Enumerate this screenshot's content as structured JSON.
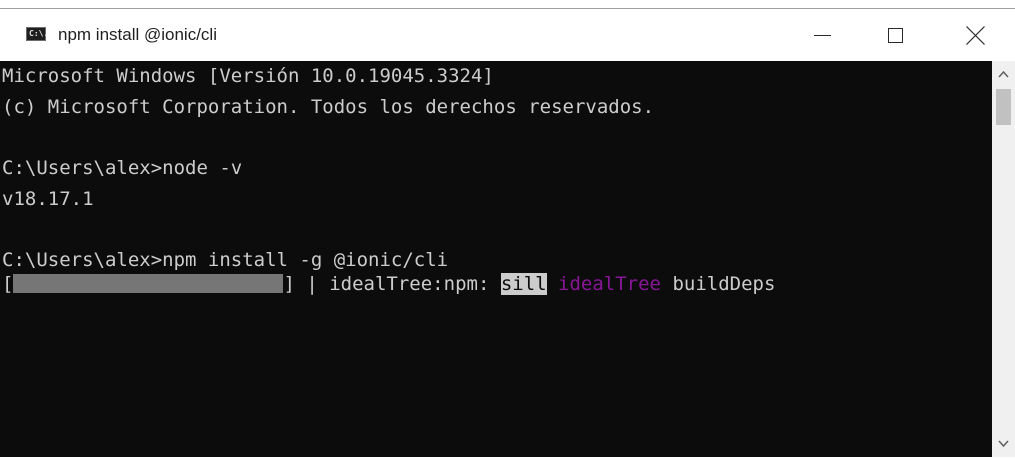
{
  "window": {
    "title": "npm install @ionic/cli",
    "icon_label": "C:\\."
  },
  "controls": {
    "minimize": "minimize-icon",
    "maximize": "maximize-icon",
    "close": "close-icon"
  },
  "console": {
    "line1": "Microsoft Windows [Versión 10.0.19045.3324]",
    "line2": "(c) Microsoft Corporation. Todos los derechos reservados.",
    "line3": "C:\\Users\\alex>node -v",
    "line4": "v18.17.1",
    "line5": "C:\\Users\\alex>npm install -g @ionic/cli",
    "progress": {
      "bracket_open": "[",
      "bracket_close": "]",
      "separator": " | ",
      "stage": "idealTree:npm: ",
      "level": "sill",
      "space1": " ",
      "scope": "idealTree",
      "space2": " ",
      "message": "buildDeps"
    }
  },
  "colors": {
    "console_bg": "#0c0c0c",
    "console_fg": "#cccccc",
    "progress_fill": "#767676",
    "highlight_bg": "#cccccc",
    "magenta": "#881798"
  }
}
